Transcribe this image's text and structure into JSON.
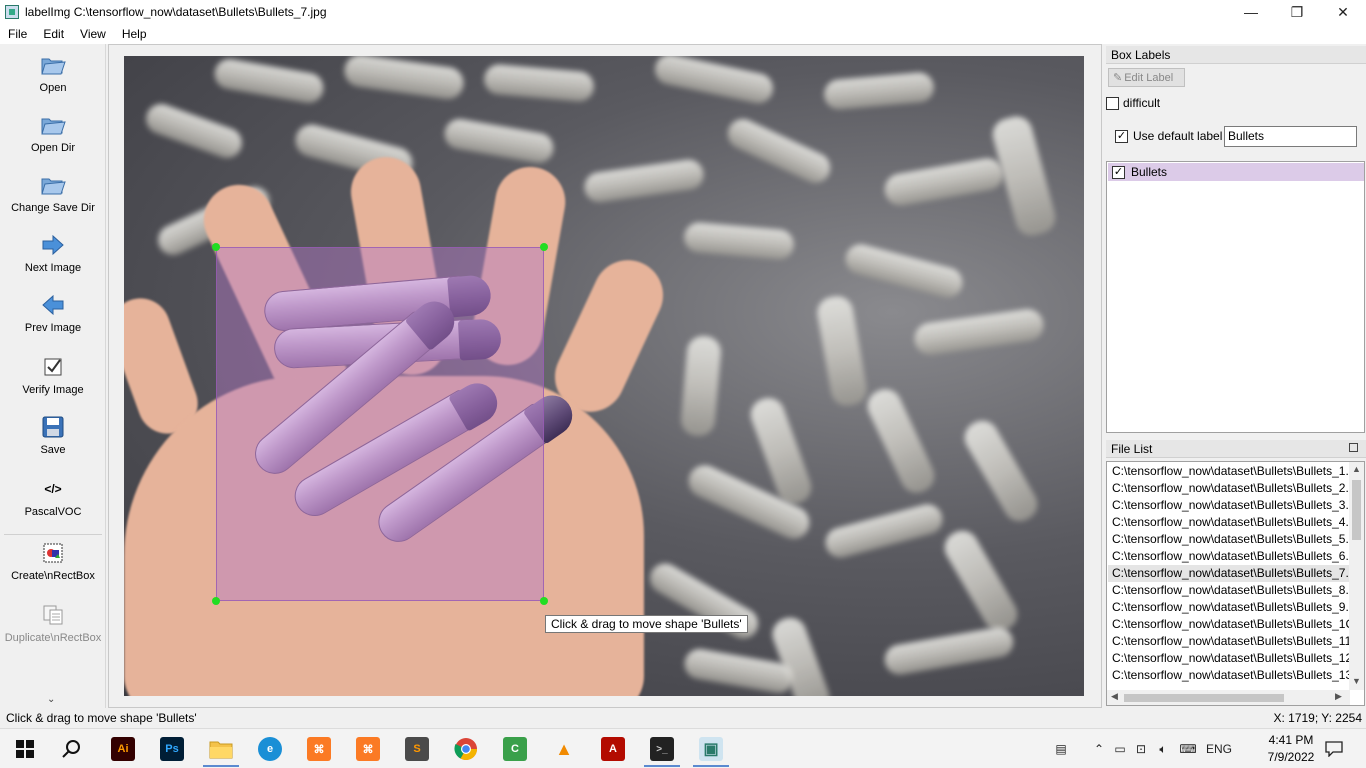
{
  "window": {
    "title": "labelImg C:\\tensorflow_now\\dataset\\Bullets\\Bullets_7.jpg",
    "minimize": "—",
    "restore": "❐",
    "close": "✕"
  },
  "menu": [
    "File",
    "Edit",
    "View",
    "Help"
  ],
  "toolbar": {
    "open": "Open",
    "open_dir": "Open Dir",
    "change_save_dir": "Change Save Dir",
    "next_image": "Next Image",
    "prev_image": "Prev Image",
    "verify_image": "Verify Image",
    "save": "Save",
    "format": "PascalVOC",
    "format_glyph": "</>",
    "create_rect": "Create\\nRectBox",
    "duplicate_rect": "Duplicate\\nRectBox",
    "more": "⌄"
  },
  "canvas": {
    "tooltip": "Click & drag to move shape 'Bullets'"
  },
  "box_labels": {
    "header": "Box Labels",
    "edit_label": "Edit Label",
    "difficult_label": "difficult",
    "difficult_checked": false,
    "use_default_label": "Use default label",
    "use_default_checked": true,
    "default_label_value": "Bullets",
    "labels": [
      {
        "text": "Bullets",
        "checked": true,
        "color": "#dccbe8"
      }
    ]
  },
  "file_list": {
    "header": "File List",
    "files": [
      "C:\\tensorflow_now\\dataset\\Bullets\\Bullets_1.",
      "C:\\tensorflow_now\\dataset\\Bullets\\Bullets_2.",
      "C:\\tensorflow_now\\dataset\\Bullets\\Bullets_3.",
      "C:\\tensorflow_now\\dataset\\Bullets\\Bullets_4.",
      "C:\\tensorflow_now\\dataset\\Bullets\\Bullets_5.",
      "C:\\tensorflow_now\\dataset\\Bullets\\Bullets_6.",
      "C:\\tensorflow_now\\dataset\\Bullets\\Bullets_7.",
      "C:\\tensorflow_now\\dataset\\Bullets\\Bullets_8.",
      "C:\\tensorflow_now\\dataset\\Bullets\\Bullets_9.",
      "C:\\tensorflow_now\\dataset\\Bullets\\Bullets_1C",
      "C:\\tensorflow_now\\dataset\\Bullets\\Bullets_11",
      "C:\\tensorflow_now\\dataset\\Bullets\\Bullets_12",
      "C:\\tensorflow_now\\dataset\\Bullets\\Bullets_13"
    ],
    "selected_index": 6
  },
  "status": {
    "message": "Click & drag to move shape 'Bullets'",
    "coords": "X: 1719; Y: 2254"
  },
  "taskbar": {
    "apps": [
      {
        "name": "illustrator",
        "glyph": "Ai",
        "color": "#330000",
        "fg": "#ff9a00"
      },
      {
        "name": "photoshop",
        "glyph": "Ps",
        "color": "#001e36",
        "fg": "#31a8ff"
      },
      {
        "name": "file-explorer",
        "glyph": "",
        "color": "#f4c24a",
        "fg": "#fff"
      },
      {
        "name": "edge",
        "glyph": "e",
        "color": "#1a8fd6",
        "fg": "#fff"
      },
      {
        "name": "xampp",
        "glyph": "⌘",
        "color": "#fb7a24",
        "fg": "#fff"
      },
      {
        "name": "xampp-2",
        "glyph": "⌘",
        "color": "#fb7a24",
        "fg": "#fff"
      },
      {
        "name": "sublime-text",
        "glyph": "S",
        "color": "#4a4a4a",
        "fg": "#ff9800"
      },
      {
        "name": "chrome",
        "glyph": "",
        "color": "#db4437",
        "fg": "#fff"
      },
      {
        "name": "camtasia",
        "glyph": "C",
        "color": "#3aa04a",
        "fg": "#fff"
      },
      {
        "name": "vlc",
        "glyph": "▲",
        "color": "#f3f3f3",
        "fg": "#f18a00"
      },
      {
        "name": "acrobat",
        "glyph": "A",
        "color": "#b30b00",
        "fg": "#fff"
      },
      {
        "name": "terminal",
        "glyph": ">_",
        "color": "#222",
        "fg": "#ccc"
      },
      {
        "name": "labelimg",
        "glyph": "▣",
        "color": "#cfe4f0",
        "fg": "#2a7a6a"
      }
    ],
    "lang": "ENG",
    "time": "4:41 PM",
    "date": "7/9/2022"
  }
}
